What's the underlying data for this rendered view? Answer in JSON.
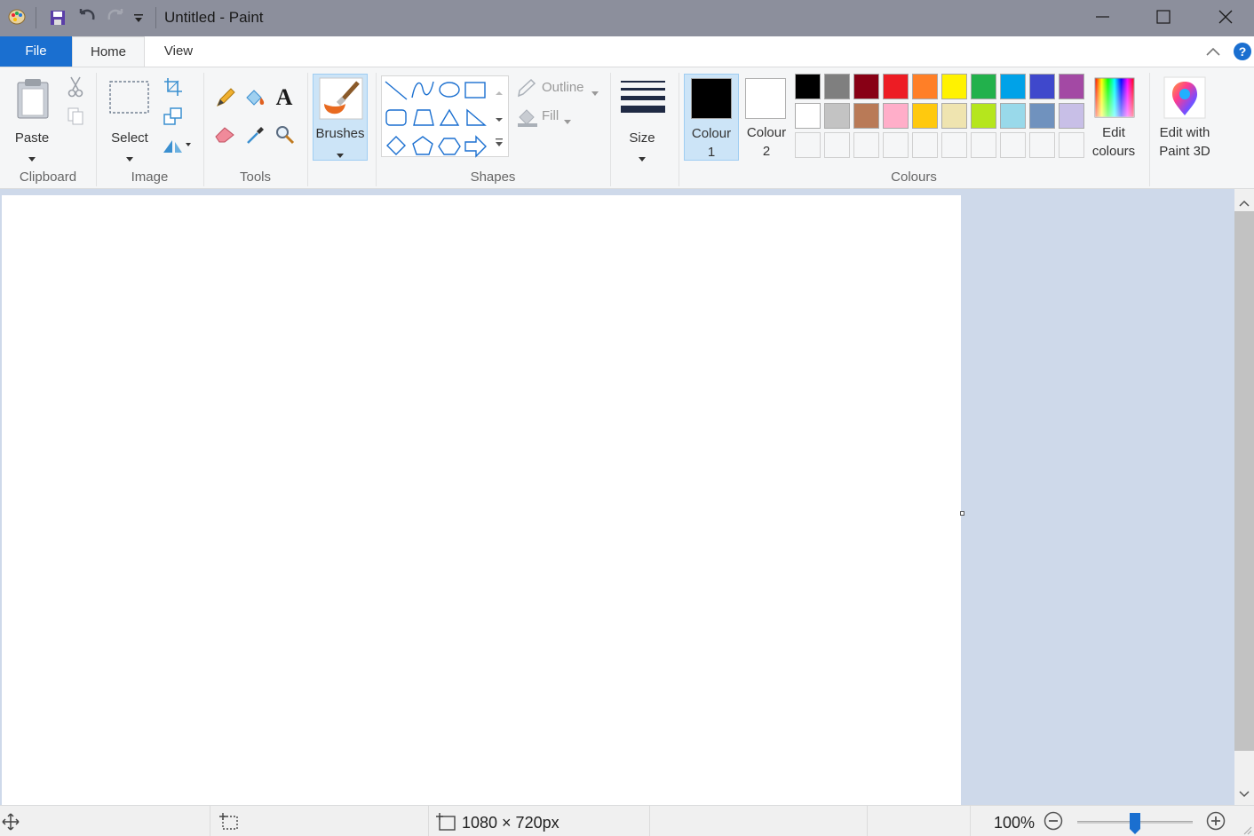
{
  "window": {
    "title": "Untitled - Paint"
  },
  "tabs": {
    "file": "File",
    "home": "Home",
    "view": "View"
  },
  "clipboard": {
    "paste_label": "Paste",
    "group_label": "Clipboard"
  },
  "image": {
    "select_label": "Select",
    "group_label": "Image"
  },
  "tools": {
    "group_label": "Tools"
  },
  "brushes": {
    "label": "Brushes"
  },
  "shapes": {
    "outline_label": "Outline",
    "fill_label": "Fill",
    "group_label": "Shapes"
  },
  "size": {
    "label": "Size"
  },
  "colours": {
    "colour1_label_a": "Colour",
    "colour1_label_b": "1",
    "colour1_value": "#000000",
    "colour2_label_a": "Colour",
    "colour2_label_b": "2",
    "colour2_value": "#ffffff",
    "edit_colours_a": "Edit",
    "edit_colours_b": "colours",
    "group_label": "Colours",
    "palette_row1": [
      "#000000",
      "#7f7f7f",
      "#880015",
      "#ed1c24",
      "#ff7f27",
      "#fff200",
      "#22b14c",
      "#00a2e8",
      "#3f48cc",
      "#a349a4"
    ],
    "palette_row2": [
      "#ffffff",
      "#c3c3c3",
      "#b97a57",
      "#ffaec9",
      "#ffc90e",
      "#efe4b0",
      "#b5e61d",
      "#99d9ea",
      "#7092be",
      "#c8bfe7"
    ]
  },
  "paint3d": {
    "label_a": "Edit with",
    "label_b": "Paint 3D"
  },
  "status": {
    "canvas_size": "1080 × 720px",
    "zoom": "100%",
    "zoom_level": 0.5
  }
}
